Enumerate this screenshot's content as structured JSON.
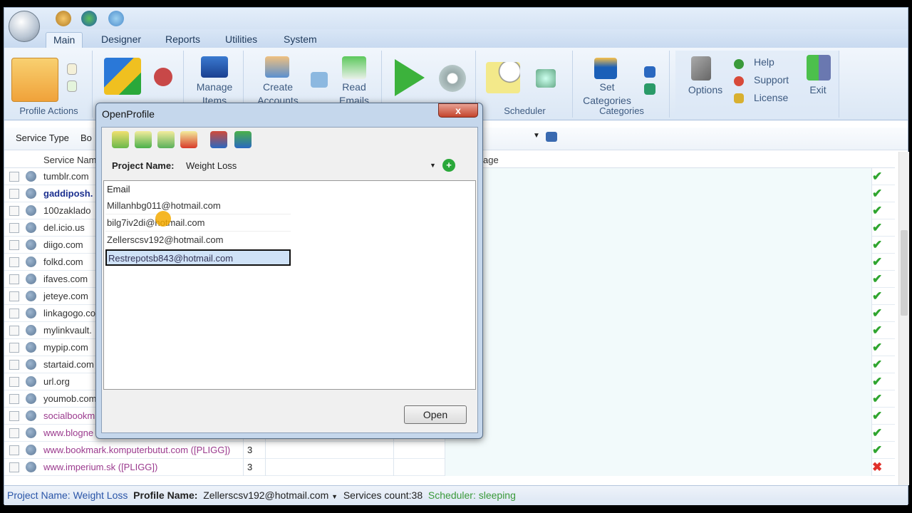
{
  "ribbon": {
    "tabs": [
      "Main",
      "Designer",
      "Reports",
      "Utilities",
      "System"
    ],
    "groups": {
      "profile_actions": "Profile Actions",
      "scheduler": "Scheduler",
      "categories": "Categories"
    },
    "buttons": {
      "manage_items": "Manage Items",
      "create_accounts": "Create Accounts",
      "read_emails": "Read Emails",
      "set_categories": "Set Categories",
      "options": "Options",
      "help": "Help",
      "support": "Support",
      "license": "License",
      "exit": "Exit"
    }
  },
  "toolbar": {
    "service_type_label": "Service Type",
    "service_type_value": "Bo"
  },
  "grid": {
    "headers": {
      "service_name": "Service Nam",
      "message": "age"
    },
    "rows": [
      {
        "name": "tumblr.com",
        "count": "",
        "status": "ok",
        "style": "normal"
      },
      {
        "name": "gaddiposh.",
        "count": "",
        "status": "ok",
        "style": "bold"
      },
      {
        "name": "100zaklado",
        "count": "",
        "status": "ok",
        "style": "normal"
      },
      {
        "name": "del.icio.us",
        "count": "",
        "status": "ok",
        "style": "normal"
      },
      {
        "name": "diigo.com",
        "count": "",
        "status": "ok",
        "style": "normal"
      },
      {
        "name": "folkd.com",
        "count": "",
        "status": "ok",
        "style": "normal"
      },
      {
        "name": "ifaves.com",
        "count": "",
        "status": "ok",
        "style": "normal"
      },
      {
        "name": "jeteye.com",
        "count": "",
        "status": "ok",
        "style": "normal"
      },
      {
        "name": "linkagogo.co",
        "count": "",
        "status": "ok",
        "style": "normal"
      },
      {
        "name": "mylinkvault.",
        "count": "",
        "status": "ok",
        "style": "normal"
      },
      {
        "name": "mypip.com",
        "count": "",
        "status": "ok",
        "style": "normal"
      },
      {
        "name": "startaid.com",
        "count": "",
        "status": "ok",
        "style": "normal"
      },
      {
        "name": "url.org",
        "count": "",
        "status": "ok",
        "style": "normal"
      },
      {
        "name": "youmob.com",
        "count": "",
        "status": "ok",
        "style": "normal"
      },
      {
        "name": "socialbookm",
        "count": "",
        "status": "ok",
        "style": "purple"
      },
      {
        "name": "www.blogne",
        "count": "",
        "status": "ok",
        "style": "purple"
      },
      {
        "name": "www.bookmark.komputerbutut.com ([PLIGG])",
        "count": "3",
        "status": "ok",
        "style": "purple"
      },
      {
        "name": "www.imperium.sk ([PLIGG])",
        "count": "3",
        "status": "error",
        "style": "purple"
      }
    ]
  },
  "dialog": {
    "title": "OpenProfile",
    "close": "x",
    "project_label": "Project Name:",
    "project_value": "Weight Loss",
    "list_header": "Email",
    "emails": [
      "Millanhbg011@hotmail.com",
      "bilg7iv2di@hotmail.com",
      "Zellerscsv192@hotmail.com",
      "Restrepotsb843@hotmail.com"
    ],
    "selected_index": 3,
    "open_label": "Open"
  },
  "status": {
    "project": "Project Name: Weight Loss",
    "profile_label": "Profile Name:",
    "profile_value": "Zellerscsv192@hotmail.com",
    "services": "Services count:38",
    "scheduler": "Scheduler: sleeping"
  },
  "colors": {
    "ok": "#2fa52f",
    "error": "#e0302a",
    "purple": "#9b3a8e",
    "bold": "#1b2f8f",
    "status_project": "#2a55a8",
    "status_scheduler": "#3a9a3a"
  }
}
